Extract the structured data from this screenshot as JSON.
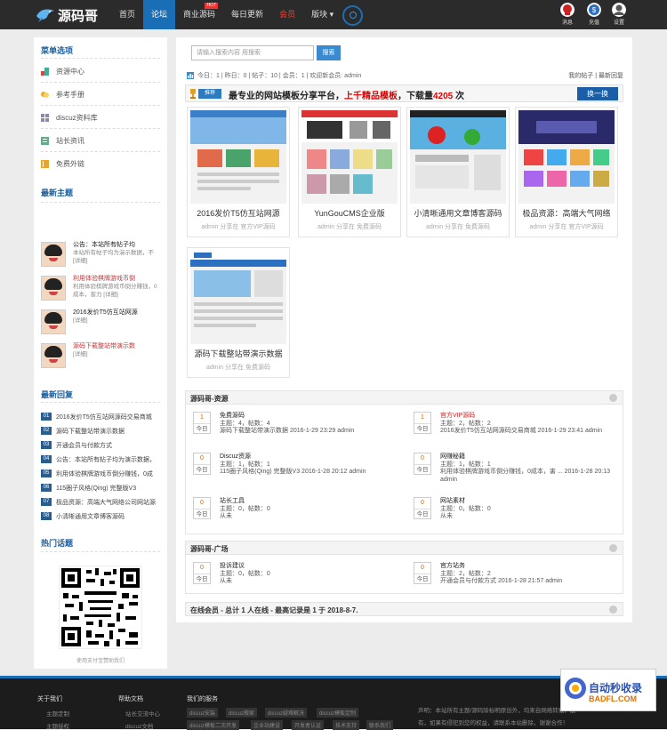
{
  "brand": {
    "name": "源码哥"
  },
  "nav": [
    {
      "label": "首页"
    },
    {
      "label": "论坛",
      "active": true
    },
    {
      "label": "商业源码",
      "badge": "HOT"
    },
    {
      "label": "每日更新"
    },
    {
      "label": "会员"
    },
    {
      "label": "版块 ▾"
    }
  ],
  "top_right": [
    "消息",
    "充值",
    "设置"
  ],
  "sidebar": {
    "menu_title": "菜单选项",
    "menu": [
      "资源中心",
      "参考手册",
      "discuz资料库",
      "站长资讯",
      "免费外链"
    ],
    "new_title": "最新主题",
    "new_posts": [
      {
        "title": "公告：本站所有帖子均",
        "desc": "本站所有帖子均为演示数据，不 [详细]"
      },
      {
        "title": "利用体验棋牌游戏币倒",
        "desc": "利用体验棋牌游戏币倒分赚钱，0成本，害力 [详细]"
      },
      {
        "title": "2016发价T5仿互站网源",
        "desc": "[详细]"
      },
      {
        "title": "源码下载整站带演示数",
        "desc": "[详细]"
      }
    ],
    "reply_title": "最新回复",
    "replies": [
      {
        "no": "01",
        "text": "2016发价T5仿互站网源码交易商城"
      },
      {
        "no": "02",
        "text": "源码下载整站带演示数据"
      },
      {
        "no": "03",
        "text": "开通会员与付款方式"
      },
      {
        "no": "04",
        "text": "公告：本站所有帖子均为演示数据，"
      },
      {
        "no": "05",
        "text": "利用体验棋牌游戏币倒分赚钱，0成"
      },
      {
        "no": "06",
        "text": "115圈子风格(Qing) 完整版V3"
      },
      {
        "no": "07",
        "text": "极品资源：高端大气网络公司网站源"
      },
      {
        "no": "08",
        "text": "小清晰通用文章博客源码"
      }
    ],
    "hot_title": "热门话题",
    "qr_caption": "使用支付宝赞助我们"
  },
  "search": {
    "placeholder": "请输入搜索内容 用搜索",
    "button": "搜索"
  },
  "stats": "今日：1 | 昨日：0 | 帖子：10 | 会员：1 | 欢迎新会员: admin",
  "top_links": "我的帖子 | 最新回复",
  "banner": {
    "badge": "推荐",
    "text_a": "最专业的网站模板分享平台，",
    "text_b": "上千精品模板",
    "text_c": "，下载量",
    "count": "4205",
    "text_d": " 次",
    "switch": "换一换"
  },
  "cards": [
    {
      "title": "2016发价T5仿互站网源",
      "by": "admin 分享在 官方VIP源码"
    },
    {
      "title": "YunGouCMS企业版",
      "by": "admin 分享在 免费源码"
    },
    {
      "title": "小清晰通用文章博客源码",
      "by": "admin 分享在 免费源码"
    },
    {
      "title": "极品资源：高端大气网络",
      "by": "admin 分享在 官方VIP源码"
    },
    {
      "title": "源码下载整站带演示数据",
      "by": "admin 分享在 免费源码"
    }
  ],
  "forum1": {
    "title": "源码哥-资源",
    "items": [
      {
        "day_num": "1",
        "day": "今日",
        "name": "免费源码",
        "stats": "主题：4，帖数：4",
        "last": "源码下载整站带演示数据 2016-1-29 23:29 admin"
      },
      {
        "day_num": "1",
        "day": "今日",
        "name": "官方VIP源码",
        "stats": "主题：2，帖数：2",
        "last": "2016发价T5仿互站网源码交易商城 2016-1-29 23:41 admin"
      },
      {
        "day_num": "0",
        "day": "今日",
        "name": "Discuz资源",
        "stats": "主题：1，帖数：1",
        "last": "115圈子风格(Qing) 完整版V3 2016-1-28 20:12 admin"
      },
      {
        "day_num": "0",
        "day": "今日",
        "name": "网赚秘籍",
        "stats": "主题：1，帖数：1",
        "last": "利用体验棋牌游戏币倒分赚钱，0成本，害 ... 2016-1-28 20:13 admin"
      },
      {
        "day_num": "0",
        "day": "今日",
        "name": "站长工具",
        "stats": "主题：0，帖数：0",
        "last": "从未"
      },
      {
        "day_num": "0",
        "day": "今日",
        "name": "网站素材",
        "stats": "主题：0，帖数：0",
        "last": "从未"
      }
    ]
  },
  "forum2": {
    "title": "源码哥-广场",
    "items": [
      {
        "day_num": "0",
        "day": "今日",
        "name": "投诉建议",
        "stats": "主题：0，帖数：0",
        "last": "从未"
      },
      {
        "day_num": "0",
        "day": "今日",
        "name": "官方站务",
        "stats": "主题：2，帖数：2",
        "last": "开通会员与付款方式 2016-1-28 21:57 admin"
      }
    ]
  },
  "online": "在线会员 - 总计 1 人在线 - 最高记录是 1 于 2018-8-7.",
  "footer": {
    "col1_title": "关于我们",
    "col1": [
      "主题定制",
      "主题授权"
    ],
    "col2_title": "帮助文档",
    "col2": [
      "站长交流中心",
      "discuz文档"
    ],
    "col3_title": "我们的服务",
    "tags1": [
      "discuz安装",
      "discuz搬家",
      "discuz疑难解决",
      "discuz模板定制"
    ],
    "tags2": [
      "discuz模板二次开发",
      "企业站建设",
      "开发者认证",
      "技术支持",
      "联系我们"
    ],
    "notice1": "声明：本站所有主题/源码除标明原创外，均来自网络转载，版",
    "notice2": "有，如果有侵犯到您的权益，请联系本站删除，谢谢合作！"
  },
  "watermark": {
    "line1": "自动秒收录",
    "line2": "BADFL.COM"
  }
}
